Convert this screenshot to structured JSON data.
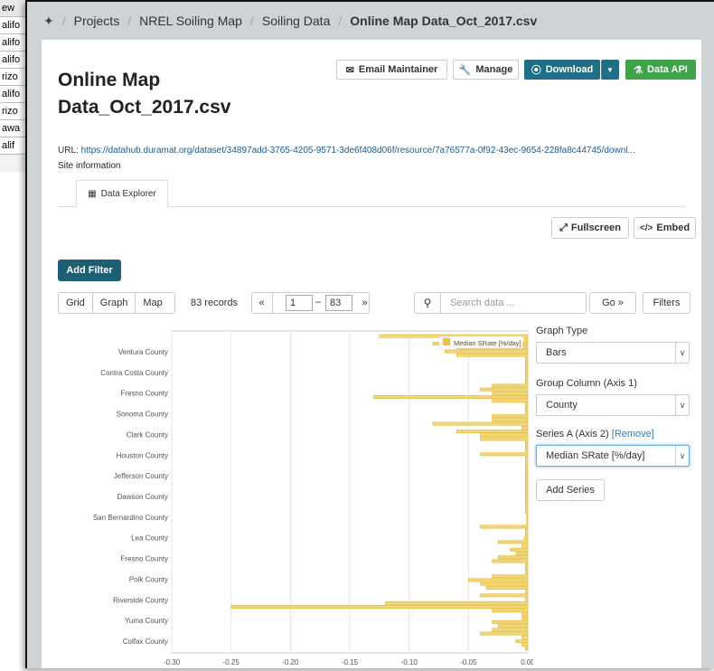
{
  "background_sheet": {
    "cells": [
      "ew",
      "alifo",
      "alifo",
      "alifo",
      "rizo",
      "alifo",
      "rizo",
      "awa",
      "alif"
    ]
  },
  "breadcrumb": {
    "items": [
      "Projects",
      "NREL Soiling Map",
      "Soiling Data"
    ],
    "current": "Online Map Data_Oct_2017.csv"
  },
  "resource": {
    "title_line1": "Online Map",
    "title_line2": "Data_Oct_2017.csv",
    "url_label": "URL:",
    "url": "https://datahub.duramat.org/dataset/34897add-3765-4205-9571-3de6f408d06f/resource/7a76577a-0f92-43ec-9654-228fa8c44745/downl...",
    "site_info": "Site information"
  },
  "actions": {
    "email": "Email Maintainer",
    "manage": "Manage",
    "download": "Download",
    "data_api": "Data API"
  },
  "tabs": {
    "explorer": "Data Explorer"
  },
  "explorer": {
    "fullscreen": "Fullscreen",
    "embed": "Embed",
    "add_filter": "Add Filter",
    "views": [
      "Grid",
      "Graph",
      "Map"
    ],
    "records": "83 records",
    "prev": "«",
    "next": "»",
    "page_from": "1",
    "page_dash": "–",
    "page_to": "83",
    "search_placeholder": "Search data ...",
    "go": "Go »",
    "filters": "Filters"
  },
  "graph_panel": {
    "graph_type_label": "Graph Type",
    "graph_type": "Bars",
    "group_label": "Group Column (Axis 1)",
    "group_value": "County",
    "series_label": "Series A (Axis 2)",
    "remove": "[Remove]",
    "series_value": "Median SRate [%/day]",
    "add_series": "Add Series"
  },
  "chart_data": {
    "type": "bar",
    "orientation": "horizontal",
    "legend": "Median SRate [%/day]",
    "legend_position": "top-right",
    "color": "#edc240",
    "xlim": [
      -0.3,
      0.0
    ],
    "x_ticks": [
      "-0.30",
      "-0.25",
      "-0.20",
      "-0.15",
      "-0.10",
      "-0.05",
      "0.00"
    ],
    "y_labels": [
      "Ventura County",
      "Contra Costa County",
      "Fresno County",
      "Sonoma County",
      "Clark County",
      "Houston County",
      "Jefferson County",
      "Dawson County",
      "San Bernardino County",
      "Lea County",
      "Fresno County",
      "Polk County",
      "Riverside County",
      "Yuma County",
      "Colfax County"
    ],
    "values": [
      -0.125,
      -0.003,
      -0.08,
      -0.06,
      -0.07,
      -0.06,
      -0.002,
      -0.002,
      -0.002,
      -0.002,
      -0.002,
      -0.002,
      -0.002,
      -0.03,
      -0.04,
      -0.03,
      -0.13,
      -0.03,
      -0.002,
      -0.002,
      -0.002,
      -0.03,
      -0.03,
      -0.08,
      -0.005,
      -0.06,
      -0.04,
      -0.04,
      -0.002,
      -0.002,
      -0.002,
      -0.04,
      -0.002,
      -0.002,
      -0.002,
      -0.002,
      -0.002,
      -0.002,
      -0.002,
      -0.002,
      -0.002,
      -0.002,
      -0.002,
      -0.002,
      -0.002,
      -0.002,
      -0.002,
      -0.001,
      -0.001,
      -0.001,
      -0.04,
      -0.002,
      -0.002,
      -0.003,
      -0.025,
      -0.005,
      -0.015,
      -0.01,
      -0.025,
      -0.03,
      -0.002,
      -0.002,
      -0.002,
      -0.03,
      -0.05,
      -0.04,
      -0.035,
      -0.002,
      -0.04,
      -0.002,
      -0.12,
      -0.25,
      -0.03,
      -0.005,
      -0.005,
      -0.03,
      -0.025,
      -0.03,
      -0.04,
      -0.005,
      -0.01,
      -0.005,
      -0.002
    ]
  }
}
